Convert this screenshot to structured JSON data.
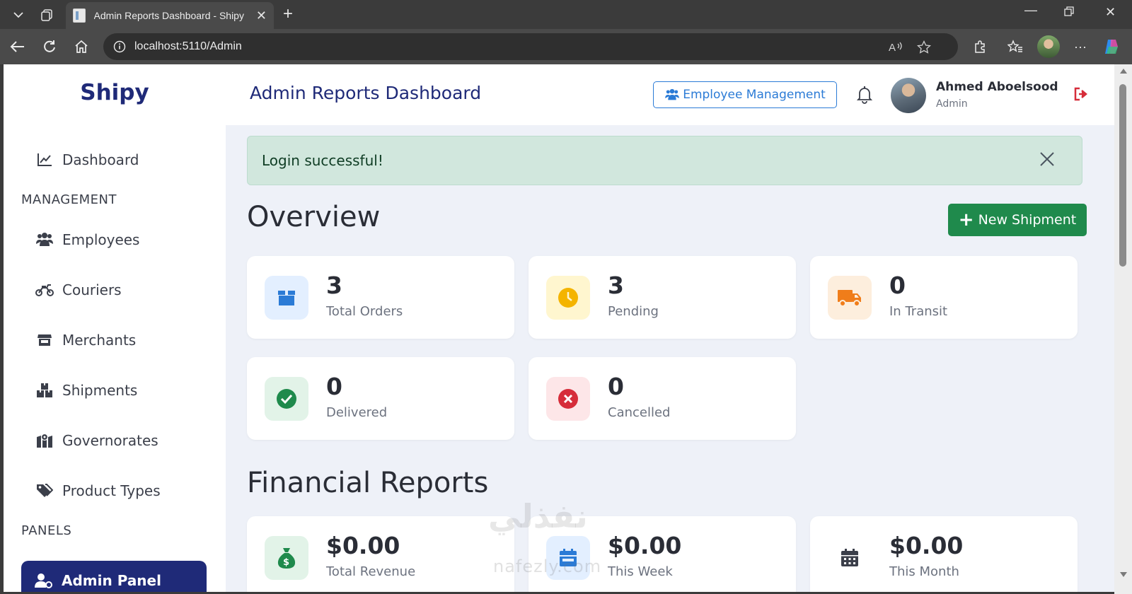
{
  "browser": {
    "tab_title": "Admin Reports Dashboard - Shipy",
    "url": "localhost:5110/Admin"
  },
  "app": {
    "brand": "Shipy",
    "page_title": "Admin Reports Dashboard"
  },
  "sidebar": {
    "dashboard_label": "Dashboard",
    "management_header": "MANAGEMENT",
    "items": [
      {
        "label": "Employees",
        "icon": "users-icon"
      },
      {
        "label": "Couriers",
        "icon": "motorcycle-icon"
      },
      {
        "label": "Merchants",
        "icon": "store-icon"
      },
      {
        "label": "Shipments",
        "icon": "boxes-icon"
      },
      {
        "label": "Governorates",
        "icon": "map-icon"
      },
      {
        "label": "Product Types",
        "icon": "tags-icon"
      }
    ],
    "panels_header": "PANELS",
    "active_item": "Admin Panel"
  },
  "header": {
    "employee_mgmt_label": "Employee Management",
    "user_name": "Ahmed Aboelsood",
    "user_role": "Admin"
  },
  "alert": {
    "message": "Login successful!"
  },
  "overview": {
    "title": "Overview",
    "new_shipment_label": "New Shipment",
    "cards": [
      {
        "value": "3",
        "label": "Total Orders",
        "icon": "box-icon",
        "color": "#2b7bd6",
        "bg": "#e3efff"
      },
      {
        "value": "3",
        "label": "Pending",
        "icon": "clock-icon",
        "color": "#f4b400",
        "bg": "#fff6cf"
      },
      {
        "value": "0",
        "label": "In Transit",
        "icon": "truck-icon",
        "color": "#f07d1a",
        "bg": "#fdeedd"
      },
      {
        "value": "0",
        "label": "Delivered",
        "icon": "check-circle-icon",
        "color": "#1f8a4c",
        "bg": "#e2f3e8"
      },
      {
        "value": "0",
        "label": "Cancelled",
        "icon": "times-circle-icon",
        "color": "#d62d3a",
        "bg": "#fde6e8"
      }
    ]
  },
  "financial": {
    "title": "Financial Reports",
    "cards": [
      {
        "value": "$0.00",
        "label": "Total Revenue",
        "icon": "money-bag-icon",
        "color": "#1f8a4c",
        "bg": "#e2f3e8"
      },
      {
        "value": "$0.00",
        "label": "This Week",
        "icon": "calendar-week-icon",
        "color": "#2b7bd6",
        "bg": "#e3efff"
      },
      {
        "value": "$0.00",
        "label": "This Month",
        "icon": "calendar-icon",
        "color": "#3b3f4a",
        "bg": "#ffffff"
      }
    ]
  },
  "watermark": {
    "text": "نفذلي",
    "sub": "nafezly.com"
  }
}
